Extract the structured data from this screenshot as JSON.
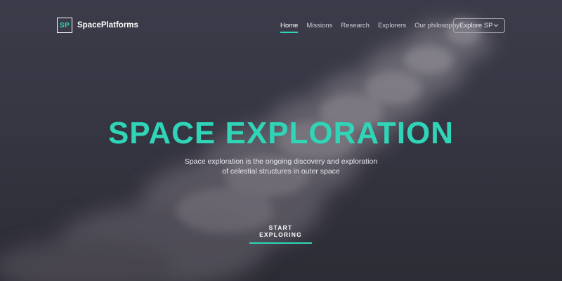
{
  "brand": {
    "logo_mark": "SP",
    "name": "SpacePlatforms",
    "accent_color": "#2fd5b6"
  },
  "nav": {
    "items": [
      {
        "label": "Home",
        "active": true
      },
      {
        "label": "Missions",
        "active": false
      },
      {
        "label": "Research",
        "active": false
      },
      {
        "label": "Explorers",
        "active": false
      },
      {
        "label": "Our philosophy",
        "active": false
      }
    ],
    "dropdown": {
      "label": "Explore SP",
      "icon": "chevron-down-icon"
    }
  },
  "hero": {
    "title": "SPACE EXPLORATION",
    "subtitle_line1": "Space exploration is the ongoing discovery and exploration",
    "subtitle_line2": "of celestial structures in outer space",
    "cta_label": "START EXPLORING"
  }
}
